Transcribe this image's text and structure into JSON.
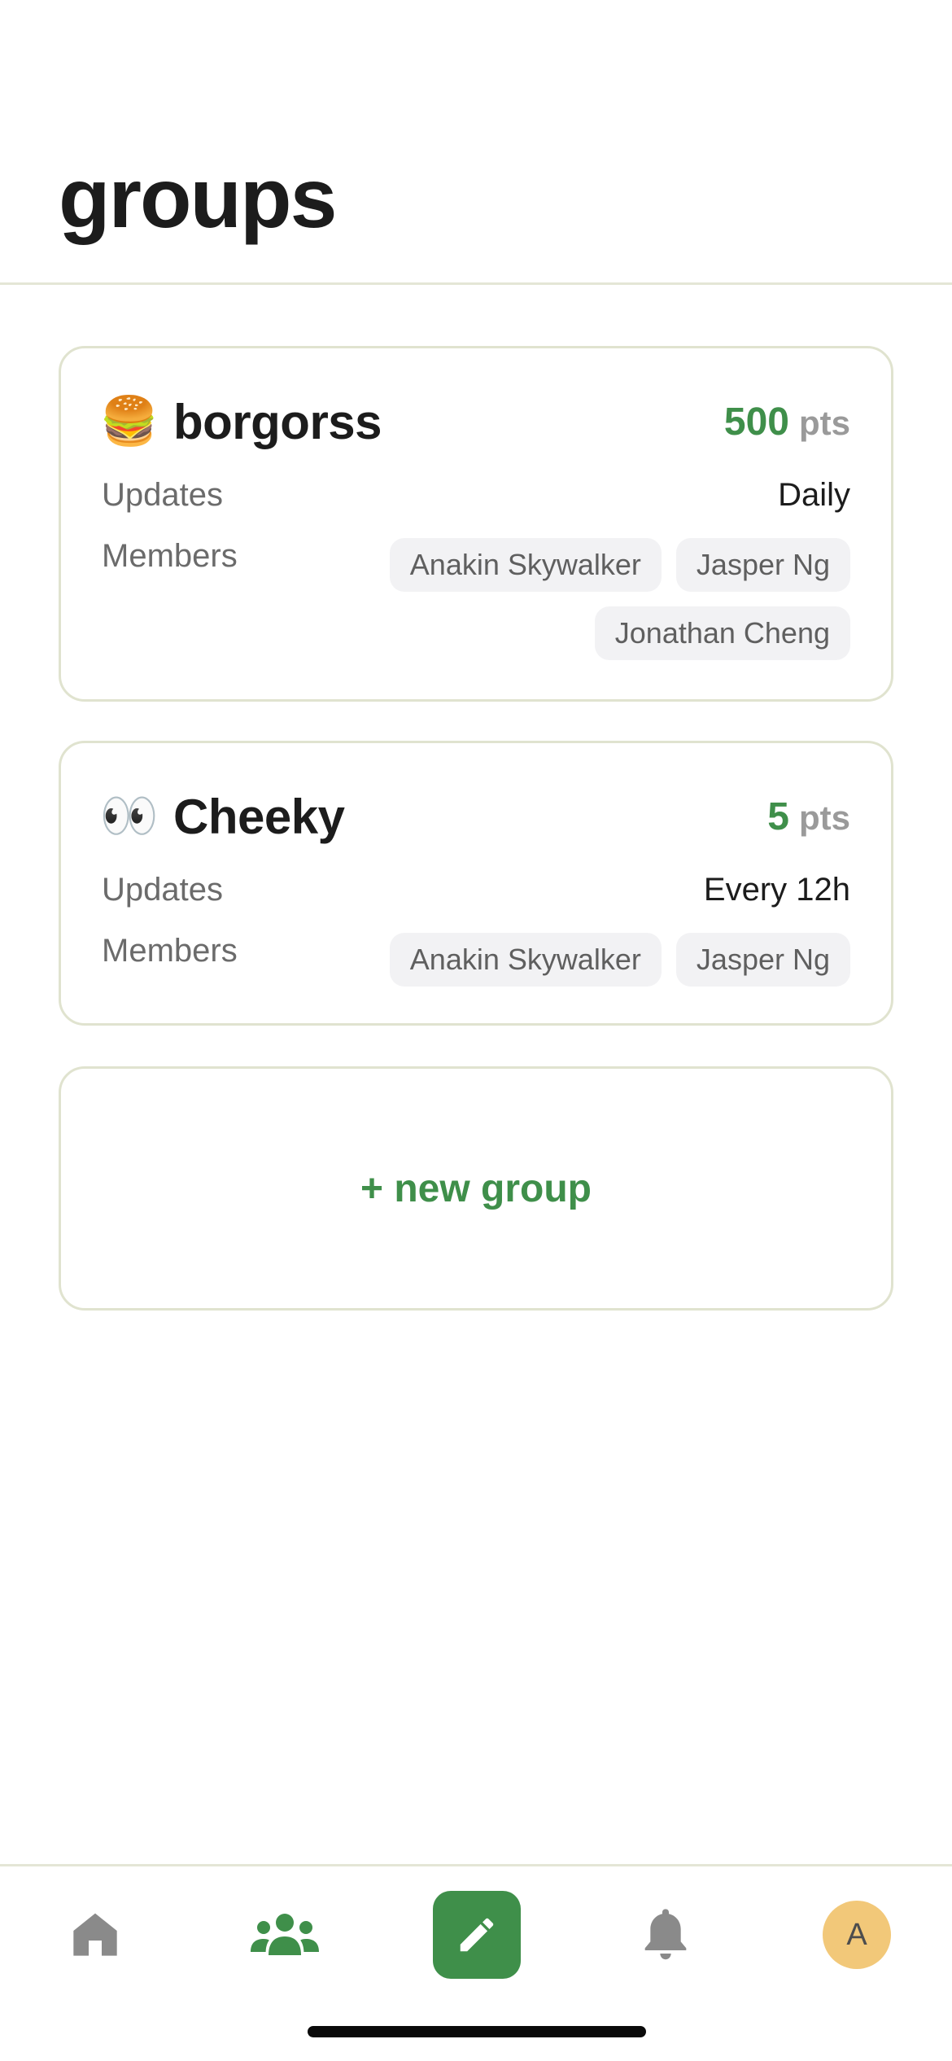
{
  "header": {
    "title": "groups"
  },
  "groups": [
    {
      "emoji": "🍔",
      "emoji_icon": "hamburger-icon",
      "name": "borgorss",
      "points": "500",
      "points_unit": "pts",
      "updates_label": "Updates",
      "updates_value": "Daily",
      "members_label": "Members",
      "members": [
        "Anakin Skywalker",
        "Jasper Ng",
        "Jonathan Cheng"
      ]
    },
    {
      "emoji": "👀",
      "emoji_icon": "eyes-icon",
      "name": "Cheeky",
      "points": "5",
      "points_unit": "pts",
      "updates_label": "Updates",
      "updates_value": "Every 12h",
      "members_label": "Members",
      "members": [
        "Anakin Skywalker",
        "Jasper Ng"
      ]
    }
  ],
  "new_group": {
    "label": "+ new group"
  },
  "tab_bar": {
    "items": [
      {
        "icon": "home-icon",
        "active": false
      },
      {
        "icon": "groups-icon",
        "active": true
      },
      {
        "icon": "pencil-icon",
        "active": false
      },
      {
        "icon": "bell-icon",
        "active": false
      },
      {
        "icon": "avatar",
        "active": false
      }
    ],
    "avatar_initial": "A"
  },
  "colors": {
    "accent": "#3f8f4a",
    "muted_icon": "#8a8a8a",
    "card_border": "#e0e3cf",
    "chip_bg": "#f2f2f4",
    "avatar_bg": "#f2c879"
  }
}
